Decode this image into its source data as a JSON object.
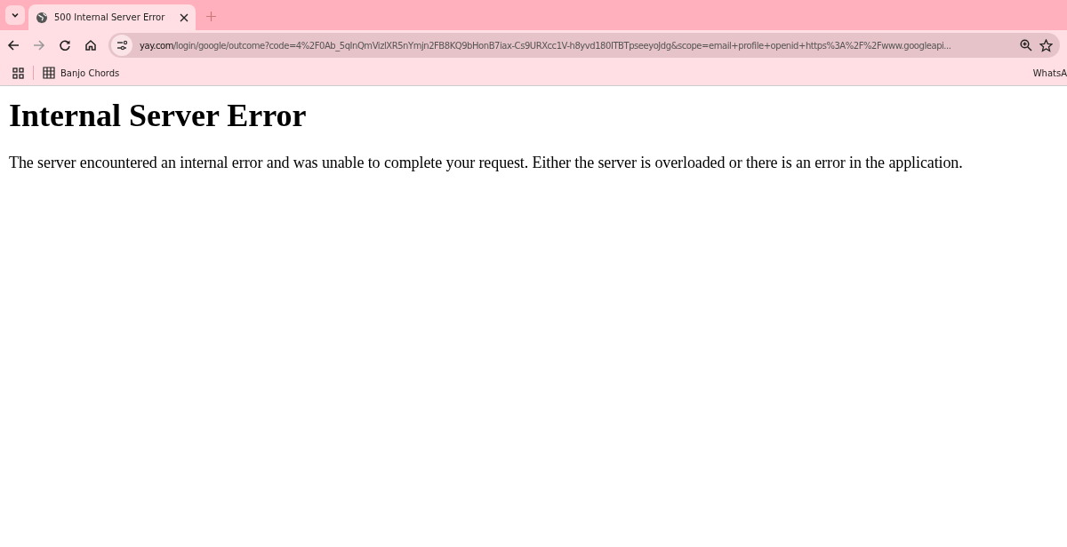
{
  "tabs": [
    {
      "title": "500 Internal Server Error",
      "selected": true
    }
  ],
  "address_bar": {
    "host": "yay.com",
    "path": "/login/google/outcome?code=4%2F0Ab_5qInQmVizlXR5nYmjn2FB8KQ9bHonB7iax-Cs9URXcc1V-h8yvd180ITBTpseeyoJdg&scope=email+profile+openid+https%3A%2F%2Fwww.googleapi..."
  },
  "bookmarks": [
    {
      "label": "Banjo Chords"
    },
    {
      "label": "WhatsA"
    }
  ],
  "page": {
    "heading": "Internal Server Error",
    "message": "The server encountered an internal error and was unable to complete your request. Either the server is overloaded or there is an error in the application."
  }
}
